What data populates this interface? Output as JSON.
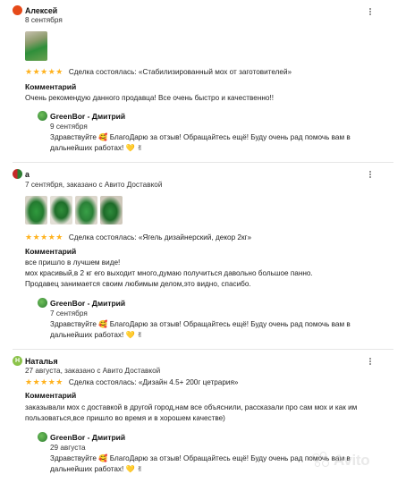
{
  "reviews": [
    {
      "author": "Алексей",
      "date": "8 сентября",
      "deal_text": "Сделка состоялась: «Стабилизированный мох от заготовителей»",
      "comment_label": "Комментарий",
      "comment": "Очень рекомендую данного продавца! Все очень быстро и качественно!!",
      "reply": {
        "author": "GreenBor - Дмитрий",
        "date": "9 сентября",
        "text": "Здравствуйте 🥰 БлагоДарю за отзыв! Обращайтесь ещё! Буду очень рад помочь вам в дальнейших работах! 💛 ✌"
      }
    },
    {
      "author": "а",
      "date": "7 сентября, заказано с Авито Доставкой",
      "deal_text": "Сделка состоялась: «Ягель дизайнерский, декор 2кг»",
      "comment_label": "Комментарий",
      "comment_lines": [
        "все пришло в лучшем виде!",
        "мох красивый,в 2 кг его выходит много,думаю получиться давольно большое панно.",
        "Продавец занимается своим любимым делом,это видно, спасибо."
      ],
      "reply": {
        "author": "GreenBor - Дмитрий",
        "date": "7 сентября",
        "text": "Здравствуйте 🥰 БлагоДарю за отзыв! Обращайтесь ещё! Буду очень рад помочь вам в дальнейших работах! 💛 ✌"
      }
    },
    {
      "author": "Наталья",
      "date": "27 августа, заказано с Авито Доставкой",
      "deal_text": "Сделка состоялась: «Дизайн 4.5+ 200г цетрария»",
      "comment_label": "Комментарий",
      "comment": "заказывали мох с доставкой в другой город,нам все объяснили, рассказали про сам мох и как им пользоваться,все пришло во время и в хорошем качестве)",
      "reply": {
        "author": "GreenBor - Дмитрий",
        "date": "29 августа",
        "text": "Здравствуйте 🥰 БлагоДарю за отзыв! Обращайтесь ещё! Буду очень рад помочь вам в дальнейших работах! 💛 ✌"
      }
    }
  ],
  "stars": "★★★★★",
  "rating": 5,
  "avatar_initial_natalya": "Н",
  "watermark": "Avito",
  "colors": {
    "star": "#ffb21e",
    "moss": "#2f8f3a"
  },
  "icons": [
    "more-vertical-icon",
    "star-icon",
    "avito-logo-icon"
  ]
}
